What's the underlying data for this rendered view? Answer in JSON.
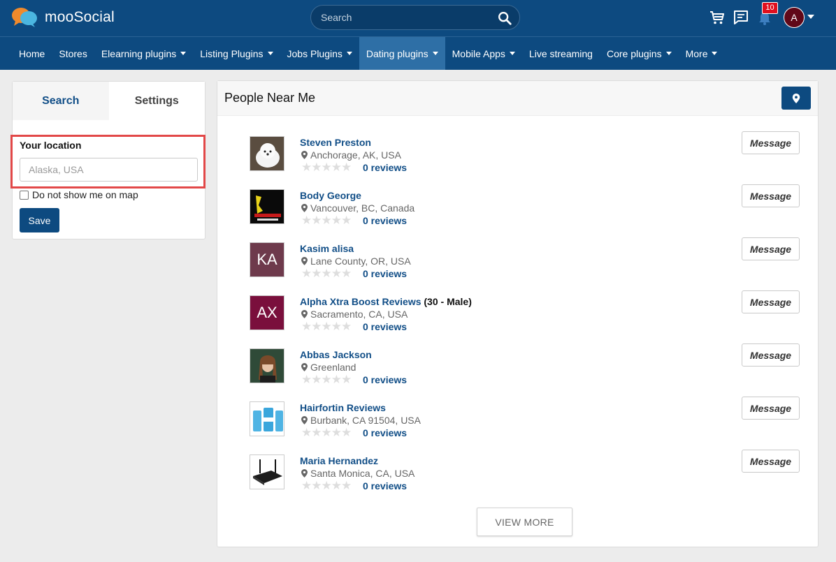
{
  "header": {
    "logo_text": "mooSocial",
    "search_placeholder": "Search",
    "notification_count": "10",
    "avatar_initial": "A",
    "icons": [
      "cart-icon",
      "chat-icon",
      "bell-icon",
      "search-icon"
    ]
  },
  "nav": {
    "items": [
      {
        "label": "Home",
        "dropdown": false,
        "active": false
      },
      {
        "label": "Stores",
        "dropdown": false,
        "active": false
      },
      {
        "label": "Elearning plugins",
        "dropdown": true,
        "active": false
      },
      {
        "label": "Listing Plugins",
        "dropdown": true,
        "active": false
      },
      {
        "label": "Jobs Plugins",
        "dropdown": true,
        "active": false
      },
      {
        "label": "Dating plugins",
        "dropdown": true,
        "active": true
      },
      {
        "label": "Mobile Apps",
        "dropdown": true,
        "active": false
      },
      {
        "label": "Live streaming",
        "dropdown": false,
        "active": false
      },
      {
        "label": "Core plugins",
        "dropdown": true,
        "active": false
      },
      {
        "label": "More",
        "dropdown": true,
        "active": false
      }
    ]
  },
  "left_panel": {
    "tab_search": "Search",
    "tab_settings": "Settings",
    "location_label": "Your location",
    "location_placeholder": "Alaska, USA",
    "hide_on_map_label": "Do not show me on map",
    "save_label": "Save"
  },
  "main": {
    "title": "People Near Me",
    "message_label": "Message",
    "view_more_label": "VIEW MORE",
    "people": [
      {
        "name": "Steven Preston",
        "extra": "",
        "location": "Anchorage, AK, USA",
        "reviews": "0 reviews",
        "thumb": "photo",
        "thumb_color": "#6b5e50"
      },
      {
        "name": "Body George",
        "extra": "",
        "location": "Vancouver, BC, Canada",
        "reviews": "0 reviews",
        "thumb": "photo",
        "thumb_color": "#111111"
      },
      {
        "name": "Kasim alisa",
        "extra": "",
        "location": "Lane County, OR, USA",
        "reviews": "0 reviews",
        "thumb": "initials",
        "initials": "KA",
        "thumb_color": "#6e3a4c"
      },
      {
        "name": "Alpha Xtra Boost Reviews",
        "extra": " (30 - Male)",
        "location": "Sacramento, CA, USA",
        "reviews": "0 reviews",
        "thumb": "initials",
        "initials": "AX",
        "thumb_color": "#7a0f3c"
      },
      {
        "name": "Abbas Jackson",
        "extra": "",
        "location": "Greenland",
        "reviews": "0 reviews",
        "thumb": "photo",
        "thumb_color": "#2f4a38"
      },
      {
        "name": "Hairfortin Reviews",
        "extra": "",
        "location": "Burbank, CA 91504, USA",
        "reviews": "0 reviews",
        "thumb": "photo",
        "thumb_color": "#6cc3e6"
      },
      {
        "name": "Maria Hernandez",
        "extra": "",
        "location": "Santa Monica, CA, USA",
        "reviews": "0 reviews",
        "thumb": "photo",
        "thumb_color": "#ffffff"
      }
    ]
  },
  "colors": {
    "brand": "#0d4a80",
    "nav_active": "#2e6fa6",
    "link": "#114e87",
    "highlight": "#e24848",
    "badge": "#e0101f"
  }
}
